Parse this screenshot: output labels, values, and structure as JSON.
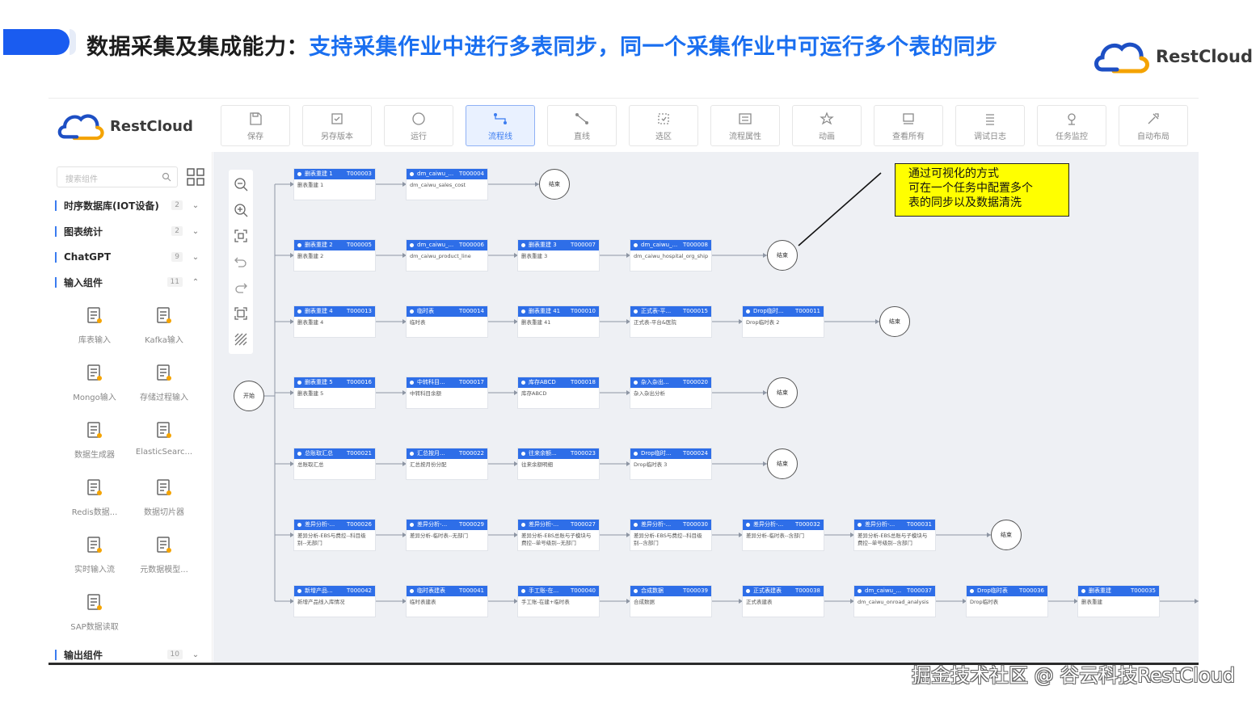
{
  "slide": {
    "title_prefix": "数据采集及集成能力：",
    "title_main": "支持采集作业中进行多表同步，同一个采集作业中可运行多个表的同步",
    "brand": "RestCloud",
    "watermark": "掘金技术社区 @ 谷云科技RestCloud",
    "callout_lines": [
      "通过可视化的方式",
      "可在一个任务中配置多个",
      "表的同步以及数据清洗"
    ],
    "colors": {
      "accent": "#1a5cf0",
      "title_blue": "#1a6ff0",
      "node_header": "#2e6ee8",
      "callout_bg": "#ffff00"
    }
  },
  "app": {
    "brand": "RestCloud",
    "toolbar": [
      {
        "label": "保存",
        "icon": "save-icon"
      },
      {
        "label": "另存版本",
        "icon": "save-version-icon"
      },
      {
        "label": "运行",
        "icon": "run-icon"
      },
      {
        "label": "流程线",
        "icon": "flow-line-icon",
        "active": true
      },
      {
        "label": "直线",
        "icon": "straight-line-icon"
      },
      {
        "label": "选区",
        "icon": "select-area-icon"
      },
      {
        "label": "流程属性",
        "icon": "flow-properties-icon"
      },
      {
        "label": "动画",
        "icon": "animation-icon"
      },
      {
        "label": "查看所有",
        "icon": "view-all-icon"
      },
      {
        "label": "调试日志",
        "icon": "debug-log-icon"
      },
      {
        "label": "任务监控",
        "icon": "task-monitor-icon"
      },
      {
        "label": "自动布局",
        "icon": "auto-layout-icon"
      }
    ],
    "sidebar": {
      "search_placeholder": "搜索组件",
      "categories": [
        {
          "label": "时序数据库(IOT设备)",
          "count": "2",
          "expanded": false
        },
        {
          "label": "图表统计",
          "count": "2",
          "expanded": false
        },
        {
          "label": "ChatGPT",
          "count": "9",
          "expanded": false
        },
        {
          "label": "输入组件",
          "count": "11",
          "expanded": true
        }
      ],
      "components": [
        {
          "label": "库表输入",
          "icon": "table-input-icon"
        },
        {
          "label": "Kafka输入",
          "icon": "kafka-input-icon"
        },
        {
          "label": "Mongo输入",
          "icon": "mongo-input-icon"
        },
        {
          "label": "存储过程输入",
          "icon": "stored-procedure-icon"
        },
        {
          "label": "数据生成器",
          "icon": "data-generator-icon"
        },
        {
          "label": "ElasticSearc...",
          "icon": "elasticsearch-icon"
        },
        {
          "label": "Redis数据...",
          "icon": "redis-icon"
        },
        {
          "label": "数据切片器",
          "icon": "data-slicer-icon"
        },
        {
          "label": "实时输入流",
          "icon": "realtime-stream-icon"
        },
        {
          "label": "元数据模型...",
          "icon": "metadata-model-icon"
        },
        {
          "label": "SAP数据读取",
          "icon": "sap-icon"
        }
      ],
      "bottom_category": {
        "label": "输出组件",
        "count": "10"
      }
    },
    "canvas": {
      "start_label": "开始",
      "end_label": "结束",
      "rows": [
        {
          "nodes": [
            {
              "name": "删表重建 1",
              "id": "T000003",
              "body": "删表重建 1"
            },
            {
              "name": "dm_caiwu_...",
              "id": "T000004",
              "body": "dm_caiwu_sales_cost"
            }
          ]
        },
        {
          "nodes": [
            {
              "name": "删表重建 2",
              "id": "T000005",
              "body": "删表重建 2"
            },
            {
              "name": "dm_caiwu_...",
              "id": "T000006",
              "body": "dm_caiwu_product_line"
            },
            {
              "name": "删表重建 3",
              "id": "T000007",
              "body": "删表重建 3"
            },
            {
              "name": "dm_caiwu_...",
              "id": "T000008",
              "body": "dm_caiwu_hospital_org_ship"
            }
          ]
        },
        {
          "nodes": [
            {
              "name": "删表重建 4",
              "id": "T000013",
              "body": "删表重建 4"
            },
            {
              "name": "临时表",
              "id": "T000014",
              "body": "临时表"
            },
            {
              "name": "删表重建 41",
              "id": "T000010",
              "body": "删表重建 41"
            },
            {
              "name": "正式表-平...",
              "id": "T000015",
              "body": "正式表-平台&医院"
            },
            {
              "name": "Drop临时...",
              "id": "T000011",
              "body": "Drop临时表 2"
            }
          ]
        },
        {
          "nodes": [
            {
              "name": "删表重建 5",
              "id": "T000016",
              "body": "删表重建 5"
            },
            {
              "name": "中转科目...",
              "id": "T000017",
              "body": "中转科目余额"
            },
            {
              "name": "库存ABCD",
              "id": "T000018",
              "body": "库存ABCD"
            },
            {
              "name": "杂入杂出...",
              "id": "T000020",
              "body": "杂入杂出分析"
            }
          ]
        },
        {
          "nodes": [
            {
              "name": "总账取汇总",
              "id": "T000021",
              "body": "总账取汇总"
            },
            {
              "name": "汇总按月...",
              "id": "T000022",
              "body": "汇总按月份分配"
            },
            {
              "name": "往来余额...",
              "id": "T000023",
              "body": "往来余额明细"
            },
            {
              "name": "Drop临时...",
              "id": "T000024",
              "body": "Drop临时表 3"
            }
          ]
        },
        {
          "nodes": [
            {
              "name": "差异分析-...",
              "id": "T000026",
              "body": "差异分析-EBS与费控--科目级别--无部门"
            },
            {
              "name": "差异分析-...",
              "id": "T000029",
              "body": "差异分析-临时表--无部门"
            },
            {
              "name": "差异分析-...",
              "id": "T000027",
              "body": "差异分析-EBS总账与子模块与费控--单号级别--无部门"
            },
            {
              "name": "差异分析-...",
              "id": "T000030",
              "body": "差异分析-EBS与费控--科目级别--含部门"
            },
            {
              "name": "差异分析-...",
              "id": "T000032",
              "body": "差异分析-临时表--含部门"
            },
            {
              "name": "差异分析-...",
              "id": "T000031",
              "body": "差异分析-EBS总账与子模块与费控--单号级别--含部门"
            }
          ]
        },
        {
          "nodes": [
            {
              "name": "新增产品...",
              "id": "T000042",
              "body": "新增产品线入库情况"
            },
            {
              "name": "临时表建表",
              "id": "T000041",
              "body": "临时表建表"
            },
            {
              "name": "手工账-在...",
              "id": "T000040",
              "body": "手工账-在建+临时表"
            },
            {
              "name": "合成数据",
              "id": "T000039",
              "body": "合成数据"
            },
            {
              "name": "正式表建表",
              "id": "T000038",
              "body": "正式表建表"
            },
            {
              "name": "dm_caiwu_...",
              "id": "T000037",
              "body": "dm_caiwu_onroad_analysis"
            },
            {
              "name": "Drop临时表",
              "id": "T000036",
              "body": "Drop临时表"
            },
            {
              "name": "删表重建",
              "id": "T000035",
              "body": "删表重建"
            }
          ]
        }
      ]
    }
  }
}
